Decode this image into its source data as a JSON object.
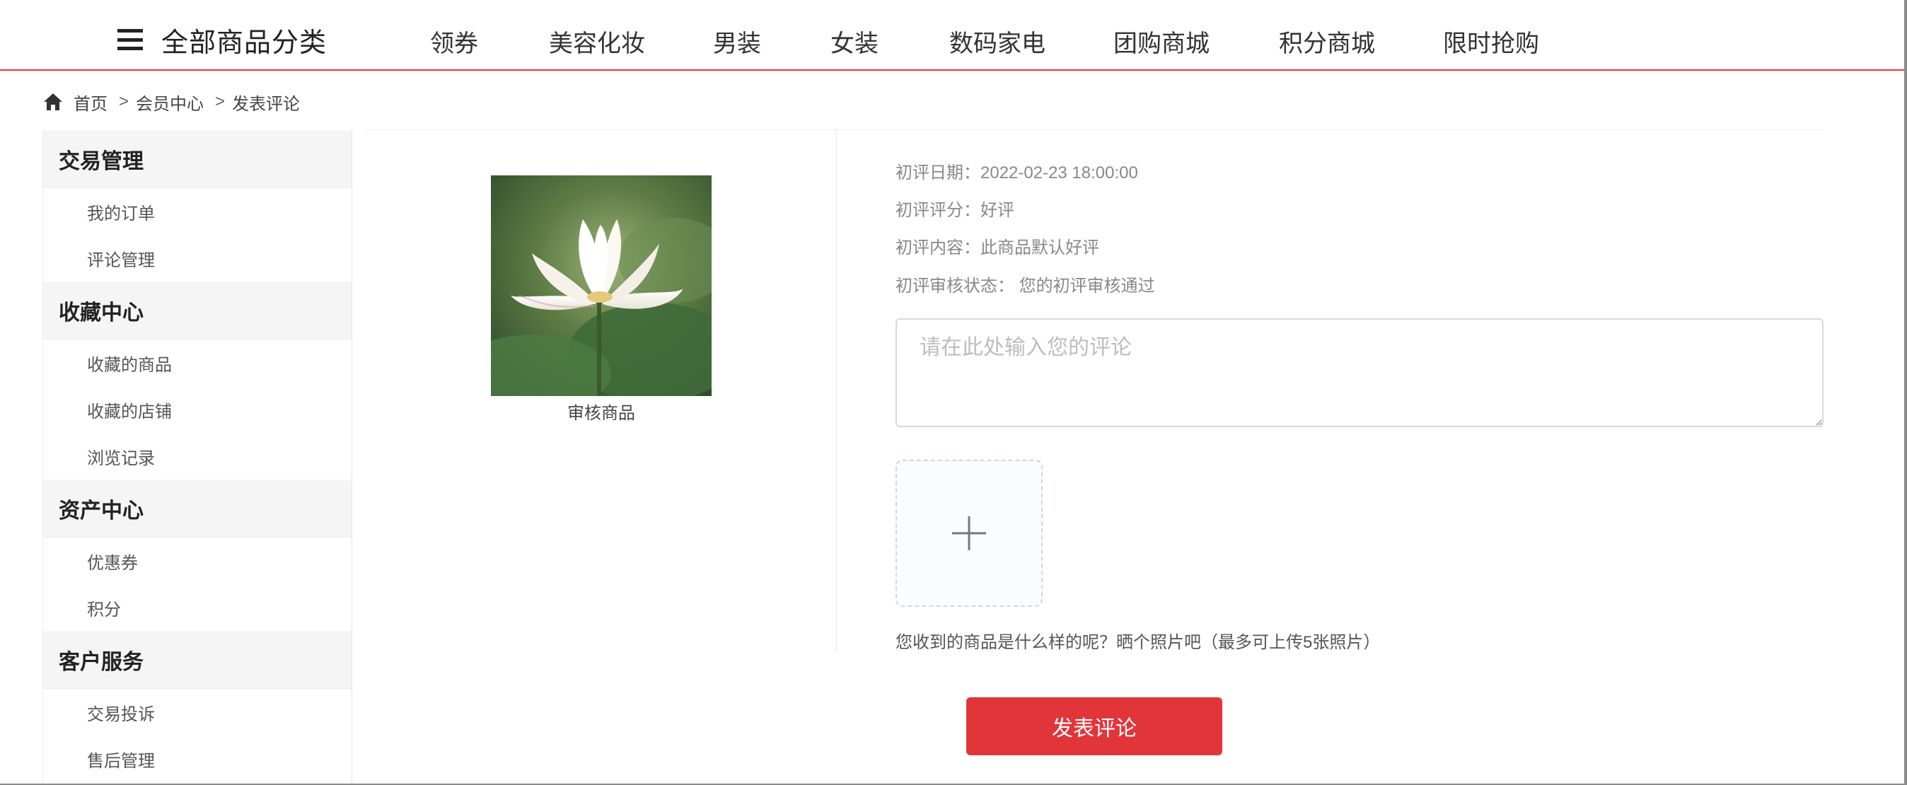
{
  "header": {
    "all_categories_label": "全部商品分类",
    "nav_items": [
      {
        "label": "领券"
      },
      {
        "label": "美容化妆"
      },
      {
        "label": "男装"
      },
      {
        "label": "女装"
      },
      {
        "label": "数码家电"
      },
      {
        "label": "团购商城"
      },
      {
        "label": "积分商城"
      },
      {
        "label": "限时抢购"
      }
    ],
    "accent_color": "#e0393e"
  },
  "breadcrumb": {
    "home_icon": "home-icon",
    "items": [
      {
        "label": "首页"
      },
      {
        "label": "会员中心"
      },
      {
        "label": "发表评论"
      }
    ],
    "separator": ">"
  },
  "sidebar": {
    "groups": [
      {
        "title": "交易管理",
        "items": [
          {
            "label": "我的订单"
          },
          {
            "label": "评论管理"
          }
        ]
      },
      {
        "title": "收藏中心",
        "items": [
          {
            "label": "收藏的商品"
          },
          {
            "label": "收藏的店铺"
          },
          {
            "label": "浏览记录"
          }
        ]
      },
      {
        "title": "资产中心",
        "items": [
          {
            "label": "优惠券"
          },
          {
            "label": "积分"
          }
        ]
      },
      {
        "title": "客户服务",
        "items": [
          {
            "label": "交易投诉"
          },
          {
            "label": "售后管理"
          }
        ]
      }
    ]
  },
  "product": {
    "caption": "审核商品"
  },
  "review_info": {
    "date_label": "初评日期：",
    "date_value": "2022-02-23 18:00:00",
    "score_label": "初评评分：",
    "score_value": "好评",
    "content_label": "初评内容：",
    "content_value": "此商品默认好评",
    "status_label": "初评审核状态：",
    "status_value": "您的初评审核通过"
  },
  "comment": {
    "placeholder": "请在此处输入您的评论",
    "value": ""
  },
  "upload": {
    "icon": "plus-icon",
    "hint": "您收到的商品是什么样的呢？晒个照片吧（最多可上传5张照片）"
  },
  "submit": {
    "label": "发表评论",
    "color": "#e2353a"
  }
}
